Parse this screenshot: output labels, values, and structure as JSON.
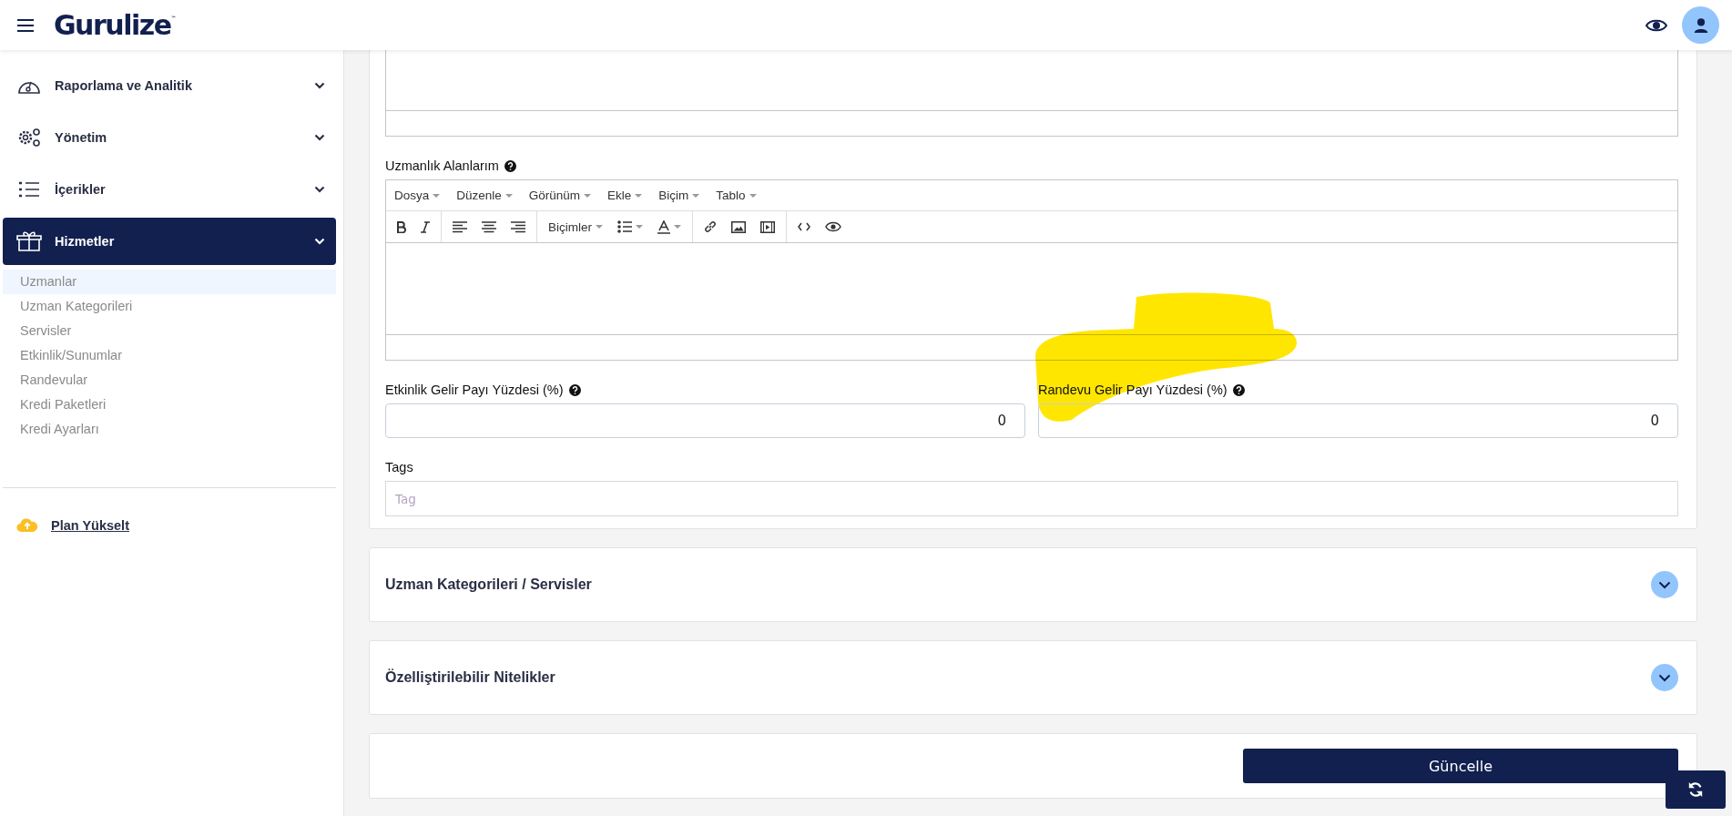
{
  "header": {
    "logo": "Gurulize",
    "logo_mark": "™"
  },
  "sidebar": {
    "menu": [
      {
        "label": "Raporlama ve Analitik",
        "kind": "gauge",
        "selected": false,
        "expanded": false
      },
      {
        "label": "Yönetim",
        "kind": "gears",
        "selected": false,
        "expanded": false
      },
      {
        "label": "İçerikler",
        "kind": "list",
        "selected": false,
        "expanded": false
      },
      {
        "label": "Hizmetler",
        "kind": "box",
        "selected": true,
        "expanded": true,
        "children": [
          {
            "label": "Uzmanlar",
            "selected": true
          },
          {
            "label": "Uzman Kategorileri",
            "selected": false
          },
          {
            "label": "Servisler",
            "selected": false
          },
          {
            "label": "Etkinlik/Sunumlar",
            "selected": false
          },
          {
            "label": "Randevular",
            "selected": false
          },
          {
            "label": "Kredi Paketleri",
            "selected": false
          },
          {
            "label": "Kredi Ayarları",
            "selected": false
          }
        ]
      }
    ],
    "upgrade": "Plan Yükselt"
  },
  "editor": {
    "label": "Uzmanlık Alanlarım",
    "menus": [
      "Dosya",
      "Düzenle",
      "Görünüm",
      "Ekle",
      "Biçim",
      "Tablo"
    ],
    "formats": "Biçimler"
  },
  "fields": [
    {
      "label": "Etkinlik Gelir Payı Yüzdesi (%)",
      "value": "0",
      "highlighted": false
    },
    {
      "label": "Randevu Gelir Payı Yüzdesi (%)",
      "value": "0",
      "highlighted": true
    }
  ],
  "tags": {
    "label": "Tags",
    "placeholder": "Tag"
  },
  "accordions": [
    {
      "title": "Uzman Kategorileri / Servisler",
      "expanded": false
    },
    {
      "title": "Özelliştirilebilir Nitelikler",
      "expanded": false
    }
  ],
  "submit": "Güncelle"
}
